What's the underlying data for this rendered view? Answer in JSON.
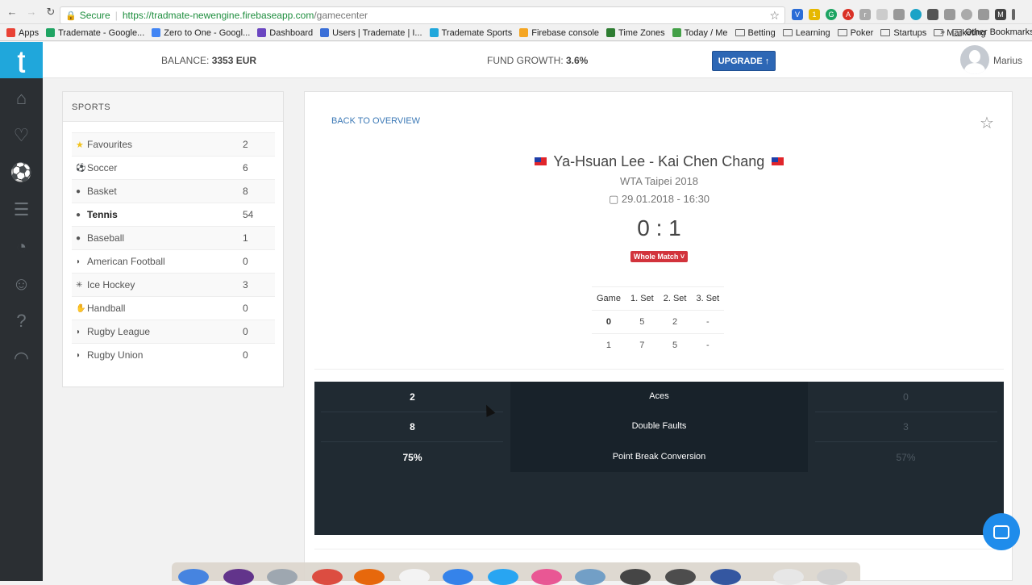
{
  "browser": {
    "secure_label": "Secure",
    "url_host": "https://tradmate-newengine.firebaseapp.com",
    "url_path": "/gamecenter",
    "bookmarks": [
      {
        "label": "Apps",
        "color": "#e94235"
      },
      {
        "label": "Trademate - Google...",
        "color": "#1fa463"
      },
      {
        "label": "Zero to One - Googl...",
        "color": "#4285f4"
      },
      {
        "label": "Dashboard",
        "color": "#6b46c1"
      },
      {
        "label": "Users | Trademate | I...",
        "color": "#3a6fd8"
      },
      {
        "label": "Trademate Sports",
        "color": "#20a7db"
      },
      {
        "label": "Firebase console",
        "color": "#f5a623"
      },
      {
        "label": "Time Zones",
        "color": "#2e7d32"
      },
      {
        "label": "Today / Me",
        "color": "#43a047"
      },
      {
        "label": "Betting",
        "color": ""
      },
      {
        "label": "Learning",
        "color": ""
      },
      {
        "label": "Poker",
        "color": ""
      },
      {
        "label": "Startups",
        "color": ""
      },
      {
        "label": "Marketing",
        "color": ""
      }
    ],
    "more_label": "»",
    "other_bookmarks": "Other Bookmarks"
  },
  "topbar": {
    "balance_label": "BALANCE:",
    "balance_value": "3353 EUR",
    "growth_label": "FUND GROWTH:",
    "growth_value": "3.6%",
    "upgrade_label": "UPGRADE ↑",
    "username": "Marius"
  },
  "sports": {
    "title": "SPORTS",
    "items": [
      {
        "name": "Favourites",
        "count": "2",
        "icon": "★"
      },
      {
        "name": "Soccer",
        "count": "6",
        "icon": "⚽"
      },
      {
        "name": "Basket",
        "count": "8",
        "icon": "●"
      },
      {
        "name": "Tennis",
        "count": "54",
        "icon": "●"
      },
      {
        "name": "Baseball",
        "count": "1",
        "icon": "●"
      },
      {
        "name": "American Football",
        "count": "0",
        "icon": "◗"
      },
      {
        "name": "Ice Hockey",
        "count": "3",
        "icon": "✳"
      },
      {
        "name": "Handball",
        "count": "0",
        "icon": "✋"
      },
      {
        "name": "Rugby League",
        "count": "0",
        "icon": "◗"
      },
      {
        "name": "Rugby Union",
        "count": "0",
        "icon": "◗"
      }
    ]
  },
  "match": {
    "back_label": "BACK TO OVERVIEW",
    "title": "Ya-Hsuan Lee - Kai Chen Chang",
    "tournament": "WTA Taipei 2018",
    "datetime": "29.01.2018 - 16:30",
    "score": "0 : 1",
    "period_badge": "Whole Match ˅",
    "sets_headers": [
      "Game",
      "1. Set",
      "2. Set",
      "3. Set"
    ],
    "sets_rows": [
      [
        "0",
        "5",
        "2",
        "-"
      ],
      [
        "1",
        "7",
        "5",
        "-"
      ]
    ],
    "stats": [
      {
        "left": "2",
        "label": "Aces",
        "right": "0"
      },
      {
        "left": "8",
        "label": "Double Faults",
        "right": "3"
      },
      {
        "left": "75%",
        "label": "Point Break Conversion",
        "right": "57%"
      }
    ]
  }
}
